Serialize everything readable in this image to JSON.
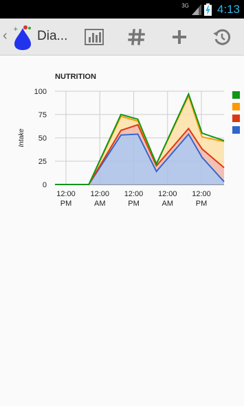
{
  "status_bar": {
    "network": "3G",
    "time": "4:13",
    "icons": [
      "signal-icon",
      "battery-charging-icon"
    ]
  },
  "action_bar": {
    "title": "Dia...",
    "icons": [
      "app-logo-icon",
      "bar-chart-icon",
      "hash-icon",
      "add-icon",
      "history-icon"
    ]
  },
  "chart_data": {
    "type": "area",
    "title": "NUTRITION",
    "ylabel": "Intake",
    "xlabel": "",
    "ylim": [
      0,
      100
    ],
    "yticks": [
      0,
      25,
      50,
      75,
      100
    ],
    "grid": true,
    "stacked": true,
    "xticks": [
      {
        "line1": "12:00",
        "line2": "PM"
      },
      {
        "line1": "12:00",
        "line2": "AM"
      },
      {
        "line1": "12:00",
        "line2": "PM"
      },
      {
        "line1": "12:00",
        "line2": "AM"
      },
      {
        "line1": "12:00",
        "line2": "PM"
      }
    ],
    "x": [
      0,
      1.0,
      1.95,
      2.45,
      3.0,
      3.95,
      4.35,
      5.0
    ],
    "series": [
      {
        "color": "#3366cc",
        "fill": "#aabfe8",
        "values": [
          0,
          0,
          53,
          54,
          14,
          54,
          29,
          3
        ]
      },
      {
        "color": "#dc3912",
        "fill": "#f0b6a8",
        "values": [
          0,
          0,
          58,
          64,
          20,
          60,
          38,
          18
        ]
      },
      {
        "color": "#ff9900",
        "fill": "#fbdfa6",
        "values": [
          0,
          0,
          73,
          68,
          22,
          95,
          51,
          46
        ]
      },
      {
        "color": "#109618",
        "fill": "none",
        "values": [
          0,
          0,
          75,
          70,
          22,
          97,
          55,
          47
        ]
      }
    ],
    "legend": {
      "placement": "right",
      "colors": [
        "#109618",
        "#ff9900",
        "#dc3912",
        "#3366cc"
      ]
    }
  }
}
